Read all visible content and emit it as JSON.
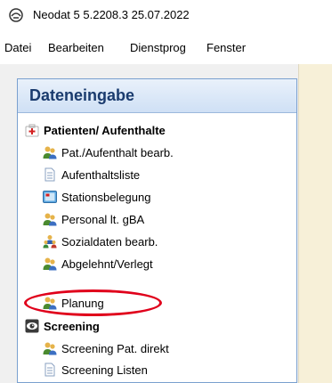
{
  "window": {
    "title": "Neodat 5 5.2208.3 25.07.2022"
  },
  "menu": [
    "Datei",
    "Bearbeiten",
    "Dienstprog",
    "Fenster"
  ],
  "panel": {
    "title": "Dateneingabe",
    "groups": [
      {
        "label": "Patienten/ Aufenthalte",
        "icon": "first-aid-kit-icon",
        "items": [
          {
            "label": "Pat./Aufenthalt bearb.",
            "icon": "users-icon"
          },
          {
            "label": "Aufenthaltsliste",
            "icon": "document-icon"
          },
          {
            "label": "Stationsbelegung",
            "icon": "monitor-icon"
          },
          {
            "label": "Personal lt. gBA",
            "icon": "users-icon"
          },
          {
            "label": "Sozialdaten bearb.",
            "icon": "people-group-icon"
          },
          {
            "label": "Abgelehnt/Verlegt",
            "icon": "users-icon"
          },
          {
            "label": "Planung",
            "icon": "users-icon",
            "highlighted": true
          }
        ]
      },
      {
        "label": "Screening",
        "icon": "eye-icon",
        "items": [
          {
            "label": "Screening Pat. direkt",
            "icon": "users-icon"
          },
          {
            "label": "Screening Listen",
            "icon": "document-icon"
          }
        ]
      }
    ]
  },
  "colors": {
    "panel_border": "#7aa0cf",
    "header_text": "#1a3b6e",
    "highlight": "#e0001b",
    "side_area": "#f7f0d8"
  }
}
